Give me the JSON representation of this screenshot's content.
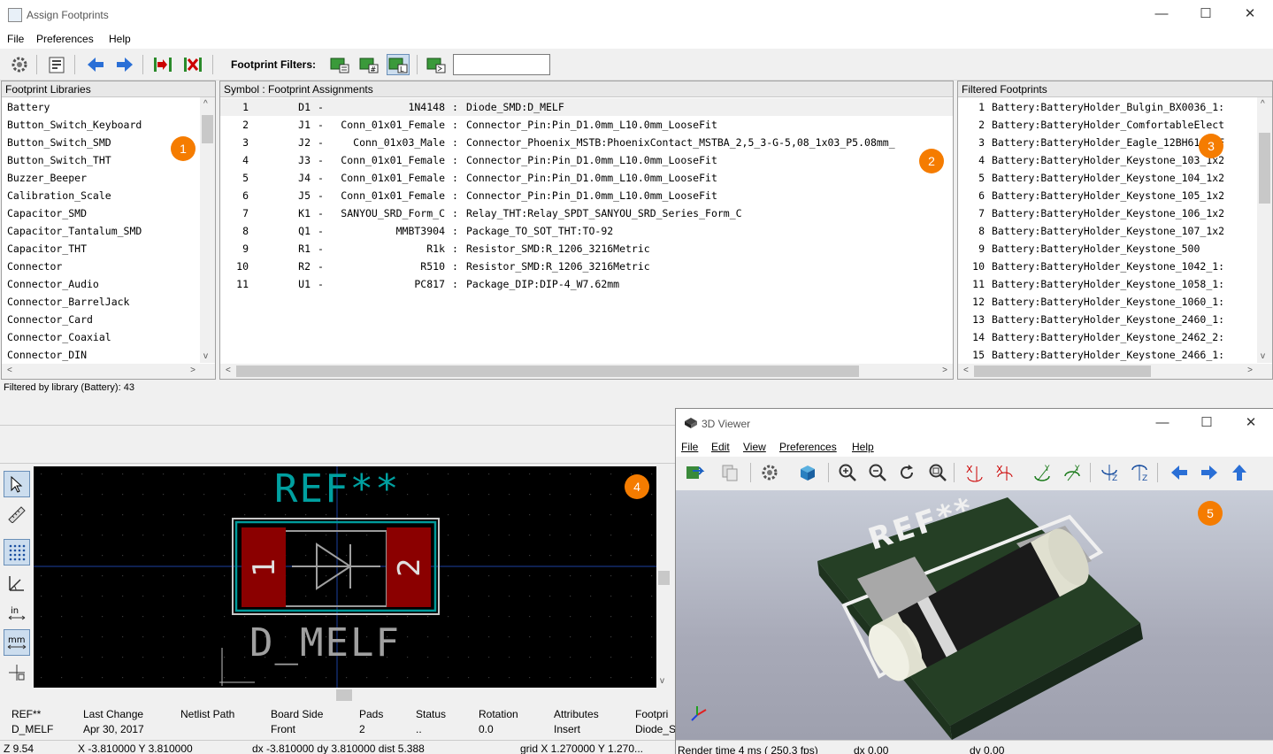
{
  "window": {
    "title": "Assign Footprints",
    "minimize": "—",
    "maximize": "☐",
    "close": "✕"
  },
  "menu": [
    "File",
    "Preferences",
    "Help"
  ],
  "toolbar": {
    "filter_label": "Footprint Filters:",
    "filter_value": ""
  },
  "libraries": {
    "header": "Footprint Libraries",
    "items": [
      "Battery",
      "Button_Switch_Keyboard",
      "Button_Switch_SMD",
      "Button_Switch_THT",
      "Buzzer_Beeper",
      "Calibration_Scale",
      "Capacitor_SMD",
      "Capacitor_Tantalum_SMD",
      "Capacitor_THT",
      "Connector",
      "Connector_Audio",
      "Connector_BarrelJack",
      "Connector_Card",
      "Connector_Coaxial",
      "Connector_DIN"
    ]
  },
  "assignments": {
    "header": "Symbol : Footprint Assignments",
    "rows": [
      {
        "num": "1",
        "ref": "D1",
        "value": "1N4148",
        "footprint": "Diode_SMD:D_MELF"
      },
      {
        "num": "2",
        "ref": "J1",
        "value": "Conn_01x01_Female",
        "footprint": "Connector_Pin:Pin_D1.0mm_L10.0mm_LooseFit"
      },
      {
        "num": "3",
        "ref": "J2",
        "value": "Conn_01x03_Male",
        "footprint": "Connector_Phoenix_MSTB:PhoenixContact_MSTBA_2,5_3-G-5,08_1x03_P5.08mm_"
      },
      {
        "num": "4",
        "ref": "J3",
        "value": "Conn_01x01_Female",
        "footprint": "Connector_Pin:Pin_D1.0mm_L10.0mm_LooseFit"
      },
      {
        "num": "5",
        "ref": "J4",
        "value": "Conn_01x01_Female",
        "footprint": "Connector_Pin:Pin_D1.0mm_L10.0mm_LooseFit"
      },
      {
        "num": "6",
        "ref": "J5",
        "value": "Conn_01x01_Female",
        "footprint": "Connector_Pin:Pin_D1.0mm_L10.0mm_LooseFit"
      },
      {
        "num": "7",
        "ref": "K1",
        "value": "SANYOU_SRD_Form_C",
        "footprint": "Relay_THT:Relay_SPDT_SANYOU_SRD_Series_Form_C"
      },
      {
        "num": "8",
        "ref": "Q1",
        "value": "MMBT3904",
        "footprint": "Package_TO_SOT_THT:TO-92"
      },
      {
        "num": "9",
        "ref": "R1",
        "value": "R1k",
        "footprint": "Resistor_SMD:R_1206_3216Metric"
      },
      {
        "num": "10",
        "ref": "R2",
        "value": "R510",
        "footprint": "Resistor_SMD:R_1206_3216Metric"
      },
      {
        "num": "11",
        "ref": "U1",
        "value": "PC817",
        "footprint": "Package_DIP:DIP-4_W7.62mm"
      }
    ]
  },
  "filtered": {
    "header": "Filtered Footprints",
    "items": [
      {
        "num": "1",
        "name": "Battery:BatteryHolder_Bulgin_BX0036_1:"
      },
      {
        "num": "2",
        "name": "Battery:BatteryHolder_ComfortableElect"
      },
      {
        "num": "3",
        "name": "Battery:BatteryHolder_Eagle_12BH611-GF"
      },
      {
        "num": "4",
        "name": "Battery:BatteryHolder_Keystone_103_1x2"
      },
      {
        "num": "5",
        "name": "Battery:BatteryHolder_Keystone_104_1x2"
      },
      {
        "num": "6",
        "name": "Battery:BatteryHolder_Keystone_105_1x2"
      },
      {
        "num": "7",
        "name": "Battery:BatteryHolder_Keystone_106_1x2"
      },
      {
        "num": "8",
        "name": "Battery:BatteryHolder_Keystone_107_1x2"
      },
      {
        "num": "9",
        "name": "Battery:BatteryHolder_Keystone_500"
      },
      {
        "num": "10",
        "name": "Battery:BatteryHolder_Keystone_1042_1:"
      },
      {
        "num": "11",
        "name": "Battery:BatteryHolder_Keystone_1058_1:"
      },
      {
        "num": "12",
        "name": "Battery:BatteryHolder_Keystone_1060_1:"
      },
      {
        "num": "13",
        "name": "Battery:BatteryHolder_Keystone_2460_1:"
      },
      {
        "num": "14",
        "name": "Battery:BatteryHolder_Keystone_2462_2:"
      },
      {
        "num": "15",
        "name": "Battery:BatteryHolder_Keystone_2466_1:"
      }
    ]
  },
  "status": {
    "filtered_text": "Filtered by library (Battery): 43"
  },
  "badges": [
    "1",
    "2",
    "3",
    "4",
    "5"
  ],
  "footprint_view": {
    "ref": "REF**",
    "value": "D_MELF",
    "pad1": "1",
    "pad2": "2"
  },
  "info": {
    "labels": [
      "REF**",
      "Last Change",
      "Netlist Path",
      "Board Side",
      "Pads",
      "Status",
      "Rotation",
      "Attributes",
      "Footpri"
    ],
    "values": [
      "D_MELF",
      "Apr 30, 2017",
      "",
      "Front",
      "2",
      "..",
      "0.0",
      "Insert",
      "Diode_S"
    ]
  },
  "statusbar": {
    "zoom": "Z 9.54",
    "xy": "X -3.810000  Y 3.810000",
    "dxy": "dx -3.810000  dy 3.810000  dist 5.388",
    "grid": "grid X 1.270000  Y 1.270...",
    "render": "Render time 4 ms ( 250.3 fps)",
    "dx1": "dx 0.00",
    "dy1": "dy 0.00"
  },
  "viewer": {
    "title": "3D Viewer",
    "menu": [
      "File",
      "Edit",
      "View",
      "Preferences",
      "Help"
    ],
    "board_text": "REF**"
  },
  "colors": {
    "badge": "#f57c00",
    "pad": "#8b0000",
    "silk": "#00a0a0",
    "board": "#2e4a2e"
  }
}
